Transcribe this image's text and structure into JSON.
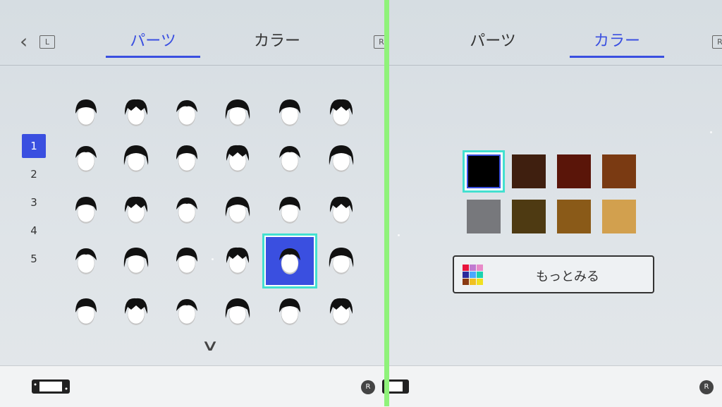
{
  "left": {
    "tabs": [
      {
        "label": "パーツ",
        "active": true
      },
      {
        "label": "カラー",
        "active": false
      }
    ],
    "keys": {
      "l": "L",
      "r": "R"
    },
    "pages": [
      "1",
      "2",
      "3",
      "4",
      "5"
    ],
    "active_page": "1",
    "hair_style_count": 30,
    "selected_hair_index": 22
  },
  "right": {
    "tabs": [
      {
        "label": "パーツ",
        "active": false
      },
      {
        "label": "カラー",
        "active": true
      }
    ],
    "keys": {
      "r": "R"
    },
    "colors": [
      "#000000",
      "#3f1f0f",
      "#5a1509",
      "#7a3a12",
      "#77787c",
      "#4e3a12",
      "#8a5a18",
      "#d2a04e"
    ],
    "selected_color_index": 0,
    "more_button": {
      "label": "もっとみる",
      "palette": [
        "#e8143c",
        "#c07ad0",
        "#e88ac8",
        "#2a2a9c",
        "#4aa8ff",
        "#1ad2b0",
        "#8a3a12",
        "#f0c020",
        "#f0e020"
      ]
    }
  },
  "bottom": {
    "r_key": "R"
  },
  "colors": {
    "accent": "#3a4fe0",
    "highlight": "#43e0d0",
    "divider": "#8ff27a"
  }
}
